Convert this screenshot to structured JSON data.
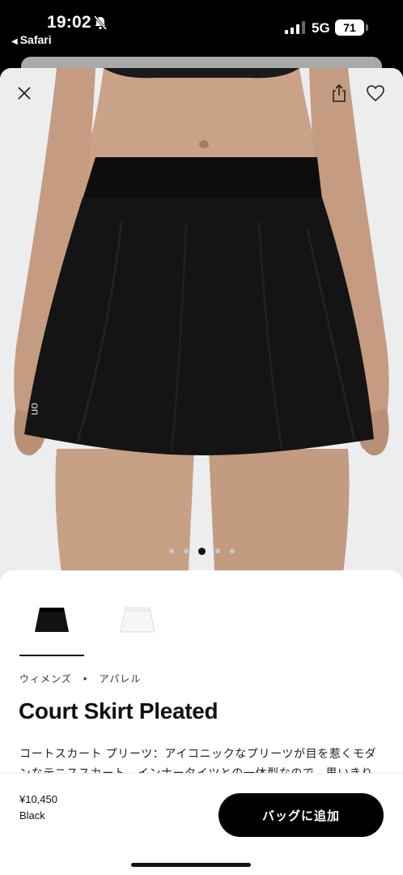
{
  "status": {
    "time": "19:02",
    "back_app": "Safari",
    "network": "5G",
    "battery": "71"
  },
  "product": {
    "name": "Court Skirt Pleated",
    "brand_mark": "on",
    "breadcrumb": [
      "ウィメンズ",
      "アパレル"
    ],
    "description": "コートスカート プリーツ：アイコニックなプリーツが目を惹くモダンなテニススカート。インナータイツとの一体型なので、思いきり",
    "price": "¥10,450",
    "color": "Black",
    "variants": [
      {
        "name": "Black",
        "swatch": "#111111",
        "selected": true
      },
      {
        "name": "White",
        "swatch": "#f4f4f6",
        "selected": false
      }
    ],
    "image_index": 3,
    "image_count": 5
  },
  "actions": {
    "add_to_bag": "バッグに追加"
  },
  "icons": {
    "close": "close-icon",
    "share": "share-icon",
    "favorite": "heart-icon",
    "mute": "bell-slash-icon"
  },
  "colors": {
    "accent": "#000000",
    "background": "#ffffff",
    "hero_bg": "#ecedef"
  }
}
